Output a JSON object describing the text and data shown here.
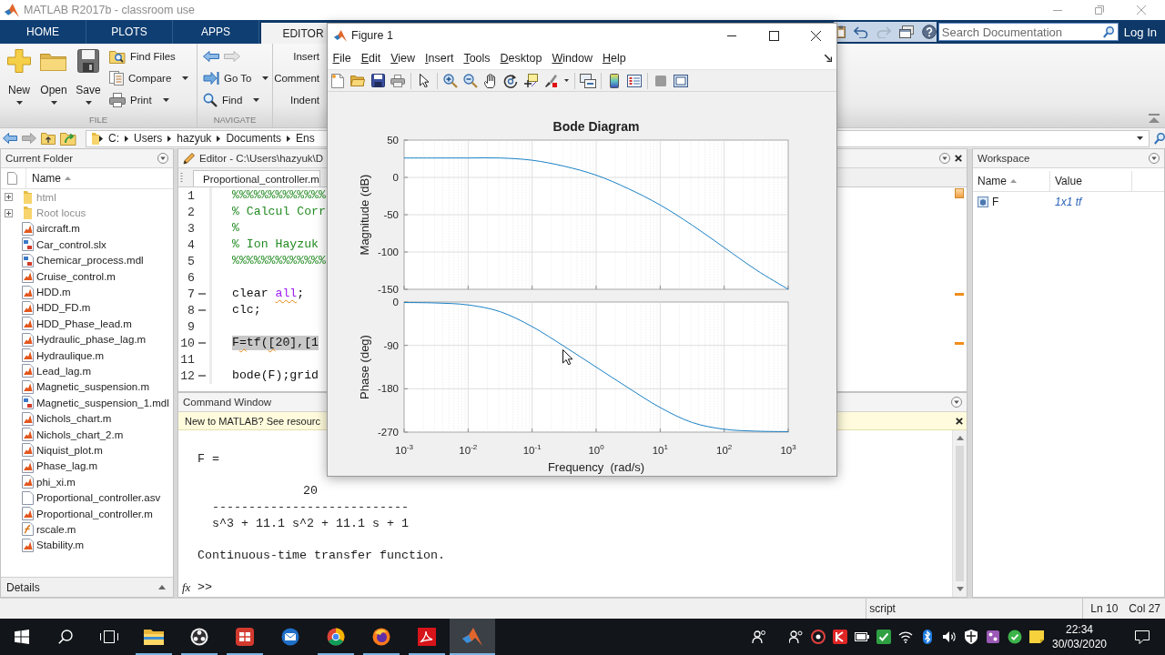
{
  "title_bar": {
    "title": "MATLAB R2017b - classroom use"
  },
  "ribbon": {
    "tabs": [
      {
        "label": "HOME",
        "selected": false
      },
      {
        "label": "PLOTS",
        "selected": false
      },
      {
        "label": "APPS",
        "selected": false
      },
      {
        "label": "EDITOR",
        "selected": true
      }
    ],
    "search": {
      "placeholder": "Search Documentation"
    },
    "login": "Log In"
  },
  "toolstrip": {
    "file": {
      "label": "FILE",
      "large_buttons": [
        {
          "label": "New",
          "kind": "new",
          "dropdown": true
        },
        {
          "label": "Open",
          "kind": "open",
          "dropdown": true
        },
        {
          "label": "Save",
          "kind": "save",
          "dropdown": true
        }
      ],
      "small_buttons": [
        {
          "label": "Find Files",
          "kind": "find_files",
          "dropdown": false
        },
        {
          "label": "Compare",
          "kind": "compare",
          "dropdown": true
        },
        {
          "label": "Print",
          "kind": "print",
          "dropdown": true
        }
      ]
    },
    "navigate": {
      "label": "NAVIGATE",
      "buttons": [
        {
          "label": "Go To",
          "kind": "goto",
          "dropdown": true
        },
        {
          "label": "Find",
          "kind": "find",
          "dropdown": true
        }
      ]
    },
    "edit": {
      "buttons": [
        "Insert",
        "Comment",
        "Indent"
      ]
    }
  },
  "address_bar": {
    "path": [
      "C:",
      "Users",
      "hazyuk",
      "Documents",
      "Ens"
    ]
  },
  "current_folder": {
    "title": "Current Folder",
    "column": {
      "label": "Name",
      "sorted": true
    },
    "items": [
      {
        "name": "html",
        "kind": "folder",
        "expanded": false,
        "on_path": false
      },
      {
        "name": "Root locus",
        "kind": "folder",
        "expanded": false,
        "on_path": false
      },
      {
        "name": "aircraft.m",
        "kind": "script",
        "on_path": true
      },
      {
        "name": "Car_control.slx",
        "kind": "model",
        "on_path": true
      },
      {
        "name": "Chemicar_process.mdl",
        "kind": "model",
        "on_path": true
      },
      {
        "name": "Cruise_control.m",
        "kind": "script",
        "on_path": true
      },
      {
        "name": "HDD.m",
        "kind": "script",
        "on_path": true
      },
      {
        "name": "HDD_FD.m",
        "kind": "script",
        "on_path": true
      },
      {
        "name": "HDD_Phase_lead.m",
        "kind": "script",
        "on_path": true
      },
      {
        "name": "Hydraulic_phase_lag.m",
        "kind": "script",
        "on_path": true
      },
      {
        "name": "Hydraulique.m",
        "kind": "script",
        "on_path": true
      },
      {
        "name": "Lead_lag.m",
        "kind": "script",
        "on_path": true
      },
      {
        "name": "Magnetic_suspension.m",
        "kind": "script",
        "on_path": true
      },
      {
        "name": "Magnetic_suspension_1.mdl",
        "kind": "model",
        "on_path": true
      },
      {
        "name": "Nichols_chart.m",
        "kind": "script",
        "on_path": true
      },
      {
        "name": "Nichols_chart_2.m",
        "kind": "script",
        "on_path": true
      },
      {
        "name": "Niquist_plot.m",
        "kind": "script",
        "on_path": true
      },
      {
        "name": "Phase_lag.m",
        "kind": "script",
        "on_path": true
      },
      {
        "name": "phi_xi.m",
        "kind": "script",
        "on_path": true
      },
      {
        "name": "Proportional_controller.asv",
        "kind": "text",
        "on_path": true
      },
      {
        "name": "Proportional_controller.m",
        "kind": "script",
        "on_path": true
      },
      {
        "name": "rscale.m",
        "kind": "function",
        "on_path": true
      },
      {
        "name": "Stability.m",
        "kind": "script",
        "on_path": true
      }
    ],
    "details": "Details"
  },
  "editor": {
    "title": "Editor - C:\\Users\\hazyuk\\D",
    "tabs": [
      {
        "label": "Proportional_controller.m",
        "selected": true
      }
    ],
    "lines": [
      {
        "number": "1",
        "executable": false,
        "warning": false,
        "selected": false,
        "tokens": [
          {
            "text": "%%%%%%%%%%%%%",
            "kind": "comment",
            "warning": false
          }
        ]
      },
      {
        "number": "2",
        "executable": false,
        "warning": false,
        "selected": false,
        "tokens": [
          {
            "text": "% Calcul Corr",
            "kind": "comment",
            "warning": false
          }
        ]
      },
      {
        "number": "3",
        "executable": false,
        "warning": false,
        "selected": false,
        "tokens": [
          {
            "text": "%",
            "kind": "comment",
            "warning": false
          }
        ]
      },
      {
        "number": "4",
        "executable": false,
        "warning": false,
        "selected": false,
        "tokens": [
          {
            "text": "% Ion Hayzuk",
            "kind": "comment",
            "warning": false
          }
        ]
      },
      {
        "number": "5",
        "executable": false,
        "warning": false,
        "selected": false,
        "tokens": [
          {
            "text": "%%%%%%%%%%%%%",
            "kind": "comment",
            "warning": false
          }
        ]
      },
      {
        "number": "6",
        "executable": false,
        "warning": false,
        "selected": false
      },
      {
        "number": "7",
        "executable": true,
        "warning": true,
        "selected": false,
        "tokens": [
          {
            "text": "clear ",
            "kind": "code",
            "warning": false
          },
          {
            "text": "all",
            "kind": "string",
            "warning": true
          },
          {
            "text": ";",
            "kind": "code",
            "warning": false
          }
        ]
      },
      {
        "number": "8",
        "executable": true,
        "warning": false,
        "selected": false,
        "tokens": [
          {
            "text": "clc;",
            "kind": "code",
            "warning": false
          }
        ]
      },
      {
        "number": "9",
        "executable": false,
        "warning": false,
        "selected": false
      },
      {
        "number": "10",
        "executable": true,
        "warning": true,
        "selected": true,
        "tokens": [
          {
            "text": "F",
            "kind": "code",
            "warning": false
          },
          {
            "text": "=",
            "kind": "code",
            "warning": true
          },
          {
            "text": "tf(",
            "kind": "code",
            "warning": false
          },
          {
            "text": "[",
            "kind": "code",
            "warning": true
          },
          {
            "text": "20],[1",
            "kind": "code",
            "warning": false
          }
        ]
      },
      {
        "number": "11",
        "executable": false,
        "warning": false,
        "selected": false
      },
      {
        "number": "12",
        "executable": true,
        "warning": false,
        "selected": false,
        "tokens": [
          {
            "text": "bode(F);grid",
            "kind": "code",
            "warning": false
          }
        ]
      }
    ]
  },
  "command_window": {
    "title": "Command Window",
    "notice": "New to MATLAB? See resourc",
    "output": [
      {
        "kind": "text",
        "text": "F ="
      },
      {
        "kind": "fraction",
        "numerator": "20",
        "bar": "---------------------------",
        "denominator": "s^3 + 11.1 s^2 + 11.1 s + 1"
      },
      {
        "kind": "text",
        "text": "Continuous-time transfer function."
      }
    ],
    "function_button": "fx",
    "prompt": ">>"
  },
  "workspace": {
    "title": "Workspace",
    "columns": [
      {
        "label": "Name",
        "sorted": true
      },
      {
        "label": "Value",
        "sorted": false
      }
    ],
    "rows": [
      {
        "name": "F",
        "value": "1x1 tf"
      }
    ]
  },
  "status_bar": {
    "mode": "script",
    "line": "Ln 10",
    "column": "Col 27"
  },
  "taskbar": {
    "apps": [
      {
        "kind": "folder",
        "running": true,
        "selected": false
      },
      {
        "kind": "aperture",
        "running": true,
        "selected": false
      },
      {
        "kind": "badge",
        "running": true,
        "selected": false
      },
      {
        "kind": "mail",
        "running": false,
        "selected": false
      },
      {
        "kind": "ring",
        "running": true,
        "selected": false
      },
      {
        "kind": "flame",
        "running": true,
        "selected": false
      },
      {
        "kind": "document",
        "running": true,
        "selected": false
      },
      {
        "kind": "peak",
        "running": true,
        "selected": true
      }
    ],
    "time": "22:34",
    "date": "30/03/2020"
  },
  "figure_window": {
    "title": "Figure 1",
    "menu": [
      "File",
      "Edit",
      "View",
      "Insert",
      "Tools",
      "Desktop",
      "Window",
      "Help"
    ],
    "magnitude_plot": {
      "chart_data": {
        "type": "line",
        "title": "Bode Diagram",
        "ylabel": "Magnitude (dB)",
        "grid": true,
        "series": [
          {
            "color": "#0072bd",
            "values": [
              26,
              26,
              26,
              26,
              23,
              15,
              3,
              -15,
              -37,
              -64,
              -94,
              -124,
              -150
            ]
          }
        ],
        "ylim": [
          -150,
          50
        ],
        "yticks": [
          50,
          0,
          -50,
          -100,
          -150
        ]
      }
    },
    "phase_plot": {
      "chart_data": {
        "type": "line",
        "xlabel": "Frequency  (rad/s)",
        "ylabel": "Phase (deg)",
        "grid": true,
        "categories": [
          "10$^{-3}$",
          null,
          "10$^{-2}$",
          null,
          "10$^{-1}$",
          null,
          "10$^{0}$",
          null,
          "10$^{1}$",
          null,
          "10$^{2}$",
          null,
          "10$^{3}$"
        ],
        "series": [
          {
            "color": "#0072bd",
            "values": [
              -1,
              -2,
              -6,
              -20,
              -51,
              -92,
              -135,
              -178,
              -219,
              -250,
              -264,
              -268,
              -269
            ]
          }
        ],
        "ylim": [
          -270,
          0
        ],
        "yticks": [
          0,
          -90,
          -180,
          -270
        ]
      }
    }
  }
}
